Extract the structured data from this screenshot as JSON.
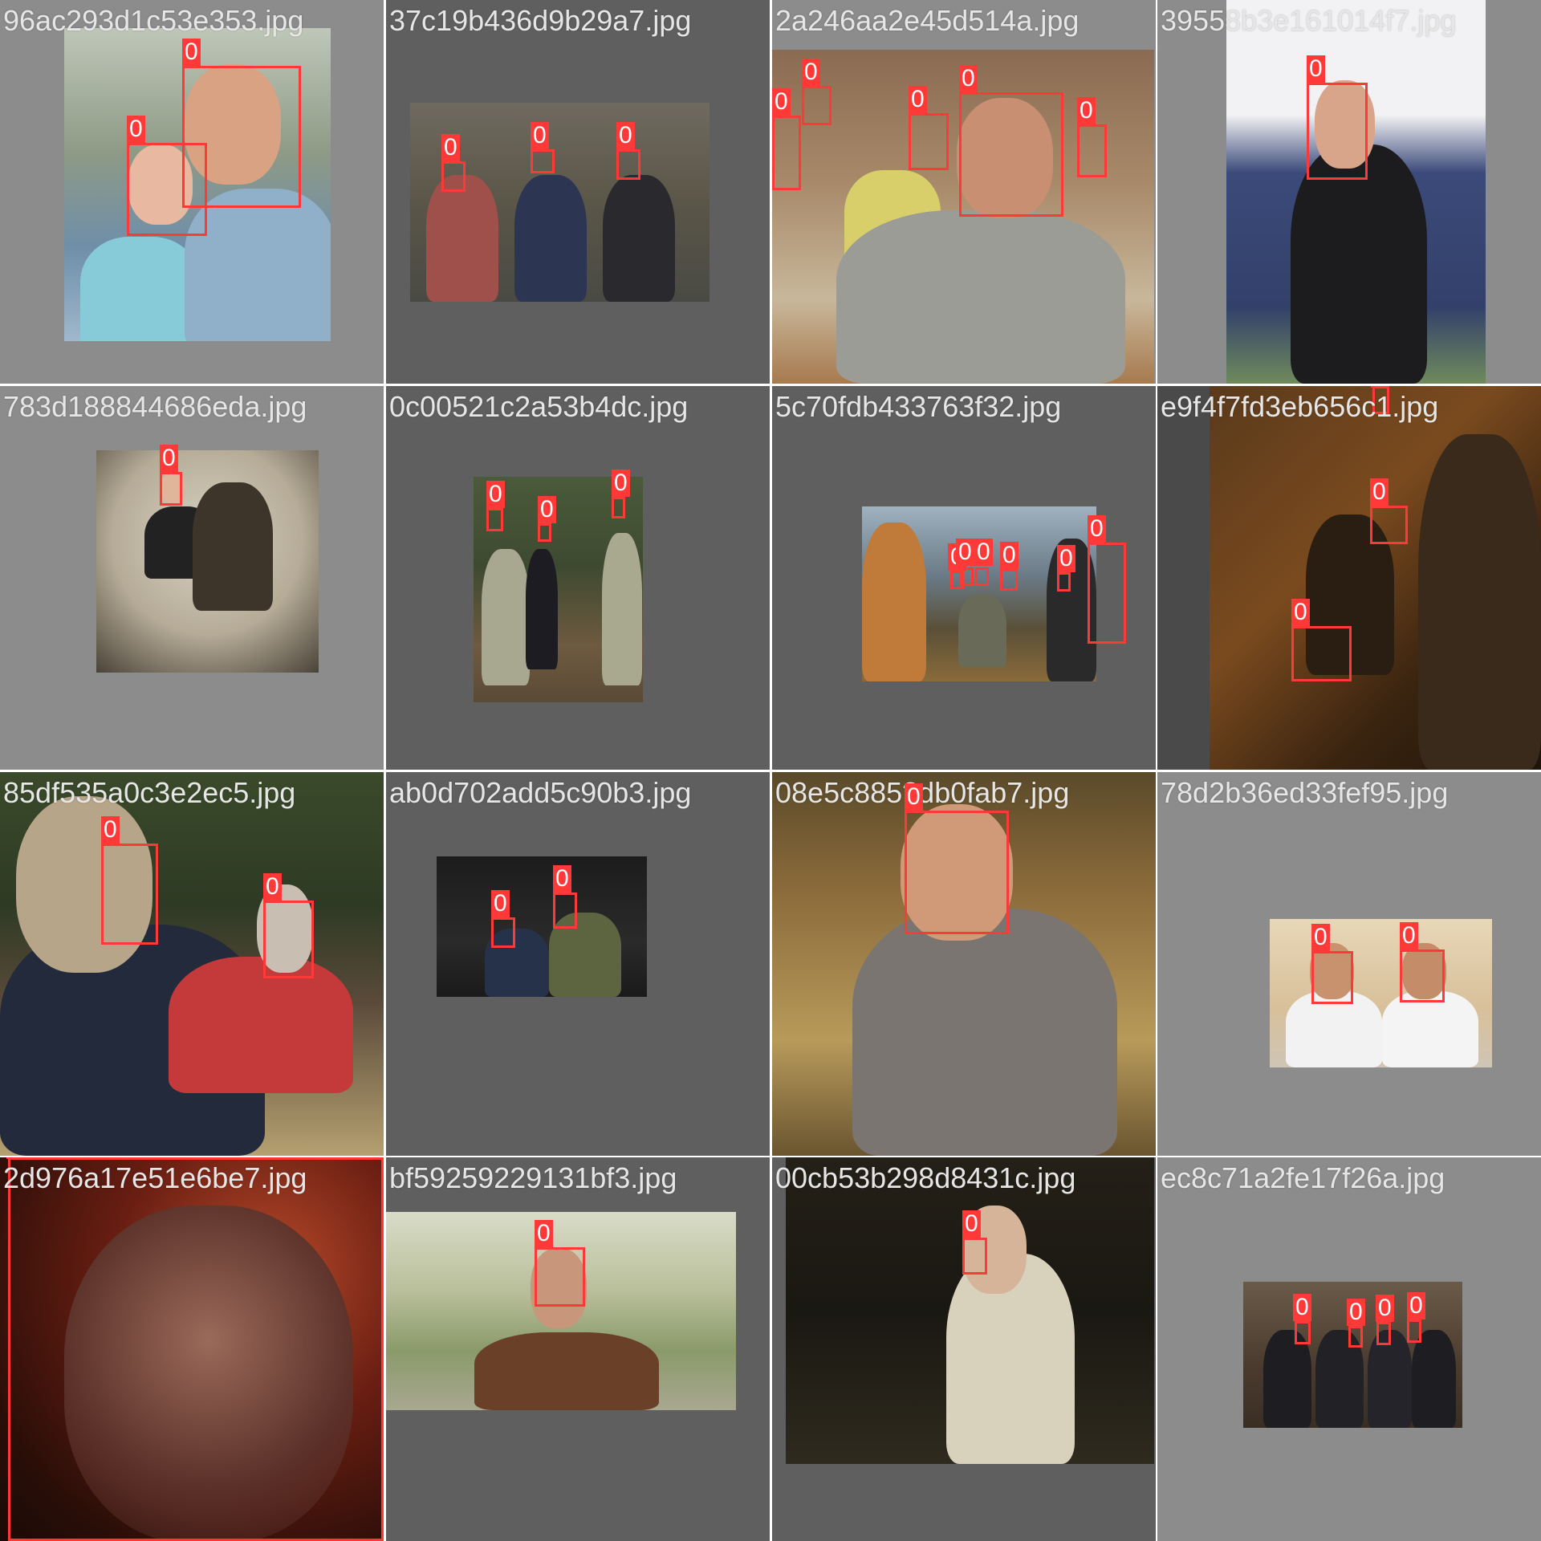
{
  "grid": {
    "tiles": [
      {
        "filename": "96ac293d1c53e353.jpg",
        "labels": [
          "0",
          "0"
        ]
      },
      {
        "filename": "37c19b436d9b29a7.jpg",
        "labels": [
          "0",
          "0",
          "0"
        ]
      },
      {
        "filename": "2a246aa2e45d514a.jpg",
        "labels": [
          "0",
          "0",
          "0",
          "0",
          "0"
        ]
      },
      {
        "filename": "39558b3e161014f7.jpg",
        "labels": [
          "0"
        ]
      },
      {
        "filename": "783d188844686eda.jpg",
        "labels": [
          "0"
        ]
      },
      {
        "filename": "0c00521c2a53b4dc.jpg",
        "labels": [
          "0",
          "0",
          "0"
        ]
      },
      {
        "filename": "5c70fdb433763f32.jpg",
        "labels": [
          "0",
          "0",
          "0",
          "0",
          "0",
          "0"
        ]
      },
      {
        "filename": "e9f4f7fd3eb656c1.jpg",
        "labels": [
          "0",
          "0",
          "0"
        ]
      },
      {
        "filename": "85df535a0c3e2ec5.jpg",
        "labels": [
          "0",
          "0"
        ]
      },
      {
        "filename": "ab0d702add5c90b3.jpg",
        "labels": [
          "0",
          "0"
        ]
      },
      {
        "filename": "08e5c885?db0fab7.jpg",
        "labels": [
          "0"
        ]
      },
      {
        "filename": "78d2b36ed33fef95.jpg",
        "labels": [
          "0",
          "0"
        ]
      },
      {
        "filename": "2d976a17e51e6be7.jpg",
        "labels": [
          "0"
        ]
      },
      {
        "filename": "bf59259229131bf3.jpg",
        "labels": [
          "0"
        ]
      },
      {
        "filename": "00cb53b298d8431c.jpg",
        "labels": [
          "0"
        ]
      },
      {
        "filename": "ec8c71a2fe17f26a.jpg",
        "labels": [
          "0",
          "0",
          "0",
          "0"
        ]
      }
    ]
  },
  "colors": {
    "box": "#ff3838",
    "filename_text": "#e6e6e6",
    "tile_bg_light": "#8c8c8c",
    "tile_bg_dark": "#5f5f5f"
  }
}
